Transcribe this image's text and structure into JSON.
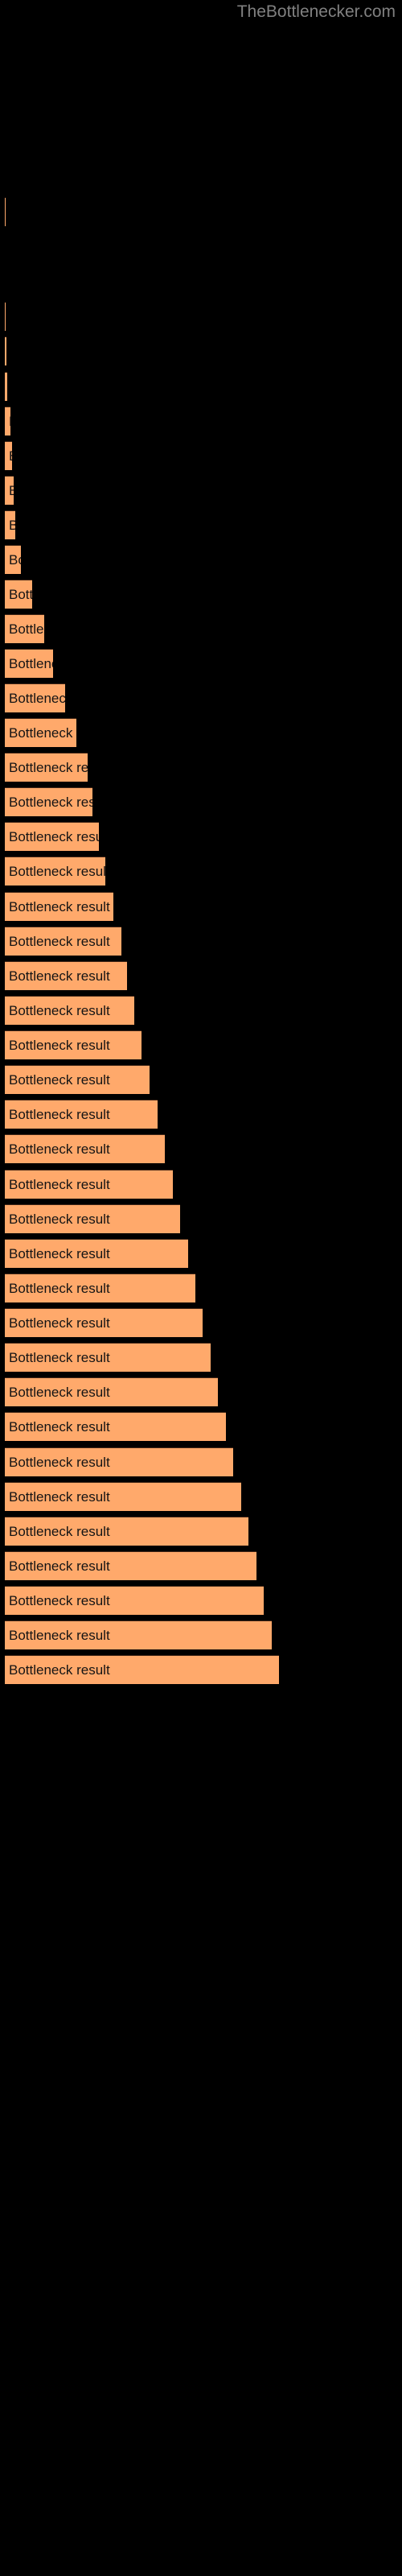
{
  "header": {
    "site_title": "TheBottlenecker.com",
    "title_color": "#808080"
  },
  "style": {
    "background": "#000000",
    "bar_fill": "#ffa96b",
    "bar_border": "#3d2415",
    "label_color": "#141414"
  },
  "chart_data": {
    "type": "bar",
    "orientation": "horizontal",
    "title": "TheBottlenecker.com",
    "xlabel": "",
    "ylabel": "",
    "grid": false,
    "legend": null,
    "bar_label_text": "Bottleneck result",
    "xlim": [
      0,
      380
    ],
    "categories": [
      "Bottleneck result",
      "Bottleneck result",
      "Bottleneck result",
      "Bottleneck result",
      "Bottleneck result",
      "Bottleneck result",
      "Bottleneck result",
      "Bottleneck result",
      "Bottleneck result",
      "Bottleneck result",
      "Bottleneck result",
      "Bottleneck result",
      "Bottleneck result",
      "Bottleneck result",
      "Bottleneck result",
      "Bottleneck result",
      "Bottleneck result",
      "Bottleneck result",
      "Bottleneck result",
      "Bottleneck result",
      "Bottleneck result",
      "Bottleneck result",
      "Bottleneck result",
      "Bottleneck result",
      "Bottleneck result",
      "Bottleneck result",
      "Bottleneck result",
      "Bottleneck result",
      "Bottleneck result",
      "Bottleneck result",
      "Bottleneck result",
      "Bottleneck result",
      "Bottleneck result",
      "Bottleneck result",
      "Bottleneck result",
      "Bottleneck result",
      "Bottleneck result",
      "Bottleneck result",
      "Bottleneck result",
      "Bottleneck result",
      "Bottleneck result"
    ],
    "values": [
      1,
      1,
      2,
      3,
      7,
      9,
      11,
      13,
      20,
      34,
      49,
      60,
      75,
      89,
      103,
      109,
      117,
      125,
      135,
      145,
      152,
      161,
      170,
      180,
      190,
      199,
      209,
      218,
      228,
      237,
      246,
      256,
      265,
      275,
      284,
      294,
      303,
      313,
      322,
      332,
      341
    ],
    "bar_tops": [
      245,
      375,
      418,
      462,
      505,
      548,
      591,
      634,
      677,
      720,
      763,
      806,
      849,
      892,
      935,
      978,
      1021,
      1064,
      1108,
      1151,
      1194,
      1237,
      1280,
      1323,
      1366,
      1409,
      1453,
      1496,
      1539,
      1582,
      1625,
      1668,
      1711,
      1754,
      1798,
      1841,
      1884,
      1927,
      1970,
      2013,
      2056
    ]
  }
}
